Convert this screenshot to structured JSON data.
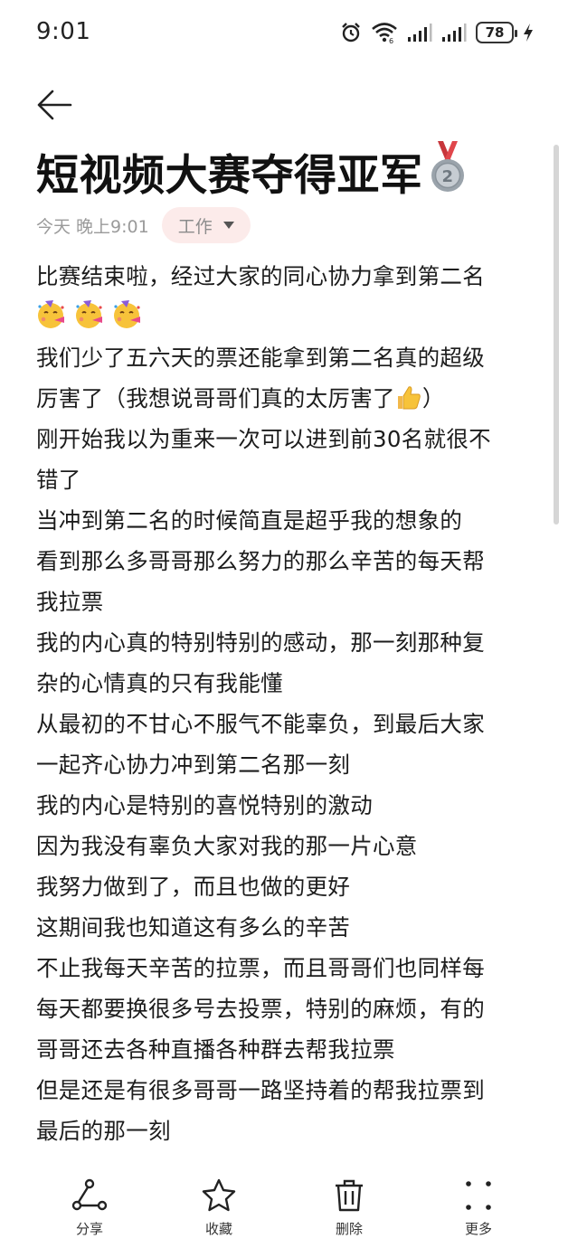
{
  "status_bar": {
    "time": "9:01",
    "battery_level": "78",
    "icons": [
      "alarm-icon",
      "wifi-icon",
      "signal-icon",
      "signal-icon",
      "battery-icon",
      "charging-icon"
    ]
  },
  "note": {
    "title": "短视频大赛夺得亚军",
    "title_icon": "second-place-medal-icon",
    "time": "今天 晚上9:01",
    "folder": "工作",
    "lines": [
      "比赛结束啦，经过大家的同心协力拿到第二名",
      "",
      "我们少了五六天的票还能拿到第二名真的超级",
      "厉害了（我想说哥哥们真的太厉害了",
      "刚开始我以为重来一次可以进到前30名就很不",
      "错了",
      "当冲到第二名的时候简直是超乎我的想象的",
      "看到那么多哥哥那么努力的那么辛苦的每天帮",
      "我拉票",
      "我的内心真的特别特别的感动，那一刻那种复",
      "杂的心情真的只有我能懂",
      "从最初的不甘心不服气不能辜负，到最后大家",
      "一起齐心协力冲到第二名那一刻",
      "我的内心是特别的喜悦特别的激动",
      "因为我没有辜负大家对我的那一片心意",
      "我努力做到了，而且也做的更好",
      "这期间我也知道这有多么的辛苦",
      "不止我每天辛苦的拉票，而且哥哥们也同样每",
      "每天都要换很多号去投票，特别的麻烦，有的",
      "哥哥还去各种直播各种群去帮我拉票",
      "但是还是有很多哥哥一路坚持着的帮我拉票到",
      "最后的那一刻"
    ],
    "line_3_suffix": "）",
    "emojis": [
      "partying-face-icon",
      "thumbs-up-icon"
    ]
  },
  "toolbar": {
    "share": "分享",
    "favorite": "收藏",
    "delete": "删除",
    "more": "更多"
  },
  "colors": {
    "tag_bg": "#fcebea",
    "text": "#1c1c1c",
    "meta": "#9a9a9a"
  }
}
